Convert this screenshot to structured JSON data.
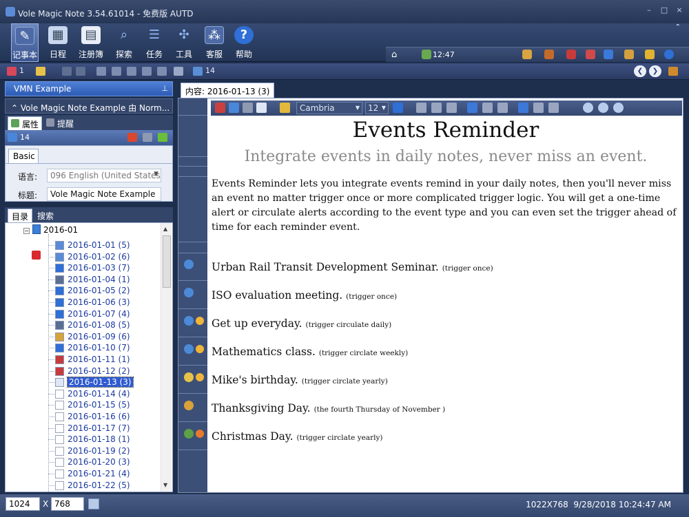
{
  "window": {
    "title": "Vole Magic Note 3.54.61014 - 免费版 AUTD",
    "controls": [
      "–",
      "□",
      "×"
    ]
  },
  "ribbon": {
    "tabs": [
      {
        "label": "记事本",
        "icon": "notebook-icon"
      },
      {
        "label": "日程",
        "icon": "calendar-icon"
      },
      {
        "label": "注册簿",
        "icon": "register-icon"
      },
      {
        "label": "探索",
        "icon": "explore-icon"
      },
      {
        "label": "任务",
        "icon": "tasks-icon"
      },
      {
        "label": "工具",
        "icon": "tools-icon"
      },
      {
        "label": "客服",
        "icon": "support-icon"
      },
      {
        "label": "帮助",
        "icon": "help-icon"
      }
    ],
    "clock": "12:47",
    "expand_symbol": "⌃"
  },
  "toolbar": {
    "counter1": "1",
    "counter2": "14"
  },
  "left": {
    "panel_title": "VMN Example",
    "note_selector": "Vole Magic Note Example 由 Norm...",
    "prop_tabs": [
      "属性",
      "提醒"
    ],
    "prop_count": "14",
    "basic_tab": "Basic",
    "language_label": "语言:",
    "language_value": "096 English (United States",
    "title_label": "标题:",
    "title_value": "Vole Magic Note Example",
    "tree_tabs": [
      "目录",
      "搜索"
    ],
    "tree_root": "2016-01",
    "tree_items": [
      "2016-01-01 (5)",
      "2016-01-02 (6)",
      "2016-01-03 (7)",
      "2016-01-04 (1)",
      "2016-01-05 (2)",
      "2016-01-06 (3)",
      "2016-01-07 (4)",
      "2016-01-08 (5)",
      "2016-01-09 (6)",
      "2016-01-10 (7)",
      "2016-01-11 (1)",
      "2016-01-12 (2)",
      "2016-01-13 (3)",
      "2016-01-14 (4)",
      "2016-01-15 (5)",
      "2016-01-16 (6)",
      "2016-01-17 (7)",
      "2016-01-18 (1)",
      "2016-01-19 (2)",
      "2016-01-20 (3)",
      "2016-01-21 (4)",
      "2016-01-22 (5)"
    ],
    "selected_item": "2016-01-13 (3)"
  },
  "content": {
    "tab_label": "内容: 2016-01-13 (3)",
    "font_name": "Cambria",
    "font_size": "12",
    "heading": "Events Reminder",
    "subheading": "Integrate events in daily notes, never miss an event.",
    "intro": "Events Reminder lets you integrate events remind in your daily notes, then you'll never miss an event no matter trigger once or more complicated trigger logic. You will get a one-time alert or circulate alerts according to the event type and you can even set the trigger ahead of time for each reminder event.",
    "events": [
      {
        "title": "Urban Rail Transit Development Seminar.",
        "trigger": "(trigger once)"
      },
      {
        "title": "ISO evaluation meeting.",
        "trigger": "(trigger once)"
      },
      {
        "title": "Get up everyday.",
        "trigger": "(trigger circulate daily)"
      },
      {
        "title": "Mathematics class.",
        "trigger": "(trigger circlate weekly)"
      },
      {
        "title": "Mike's birthday.",
        "trigger": "(trigger circlate yearly)"
      },
      {
        "title": "Thanksgiving Day.",
        "trigger": "(the fourth Thursday of November )"
      },
      {
        "title": "Christmas Day.",
        "trigger": "(trigger circlate yearly)"
      }
    ]
  },
  "status": {
    "width": "1024",
    "x_label": "X",
    "height": "768",
    "resolution": "1022X768",
    "datetime": "9/28/2018 10:24:47 AM"
  },
  "colors": {
    "chrome": "#2b3d61",
    "accent": "#2d5bb5",
    "selection": "#2f5bd1"
  }
}
